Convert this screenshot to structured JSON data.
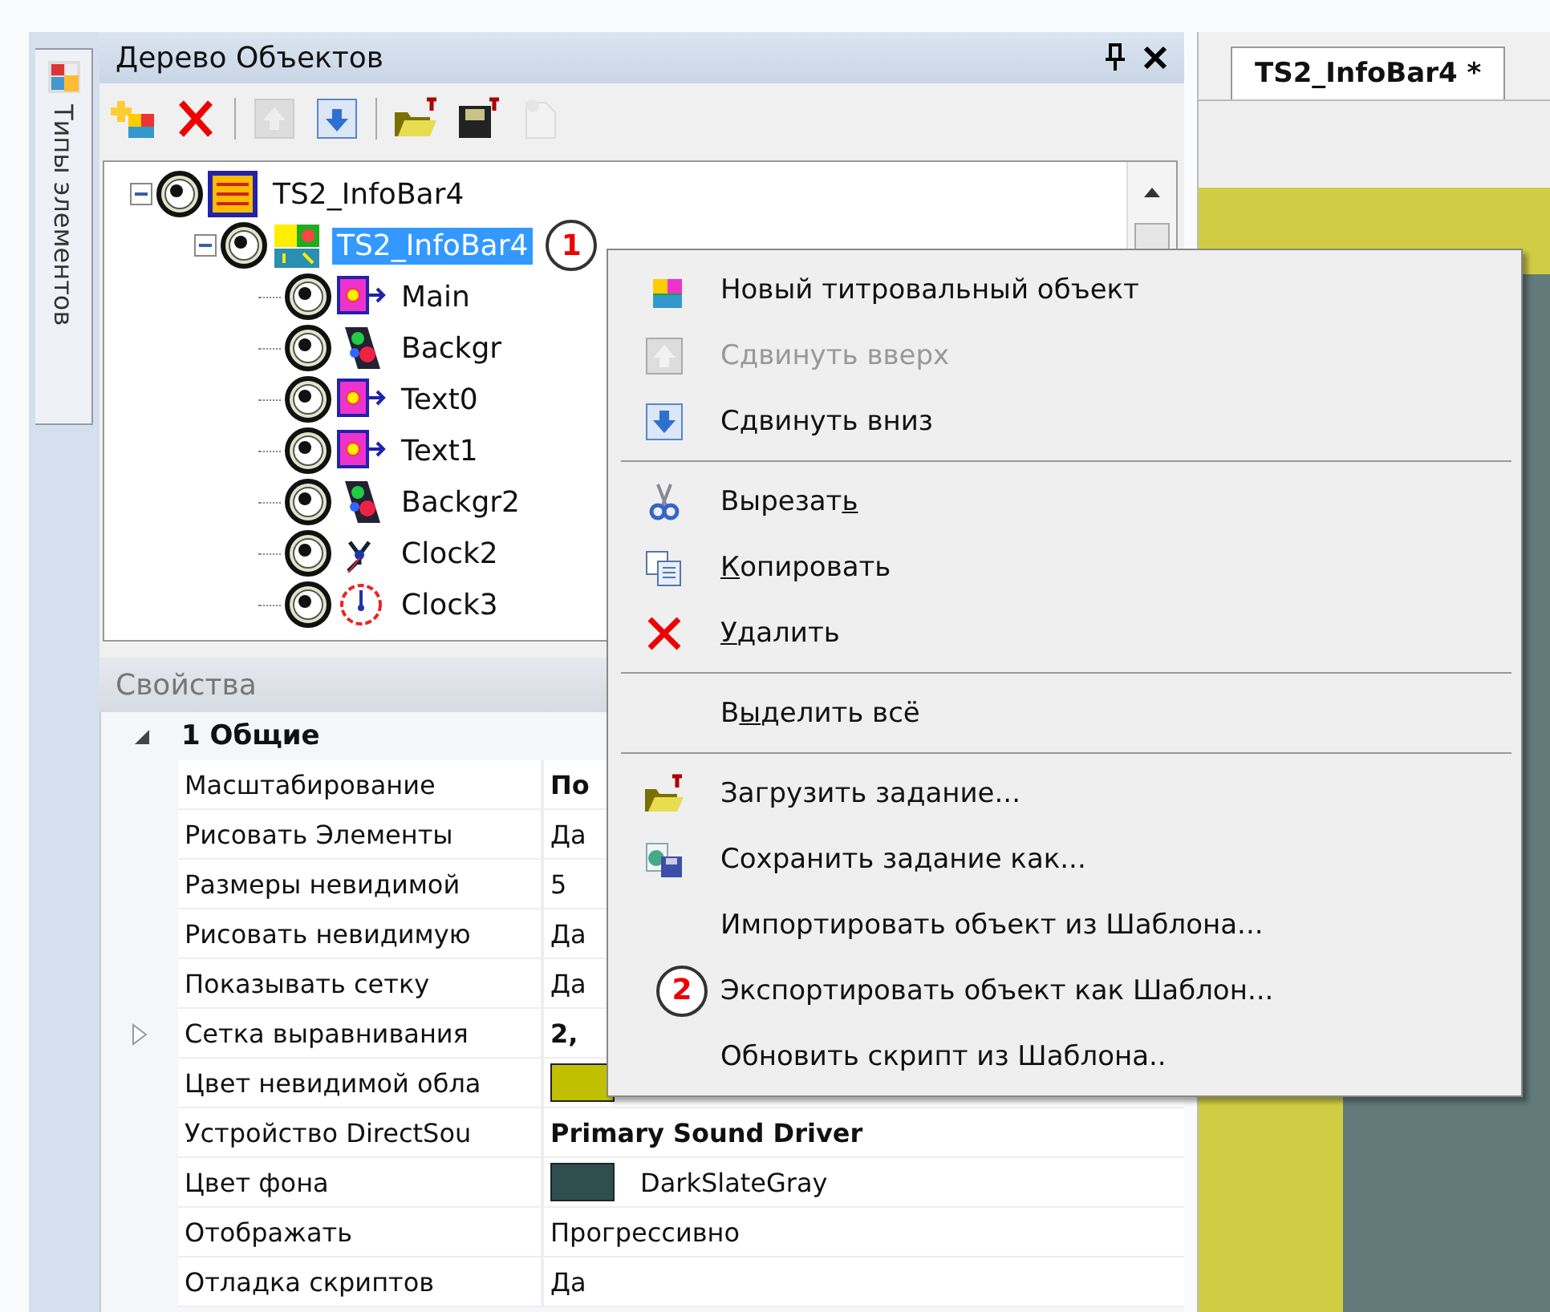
{
  "side_tab": {
    "label": "Типы элементов"
  },
  "object_tree_panel": {
    "title": "Дерево Объектов",
    "toolbar": [
      {
        "kind": "add",
        "disabled": false
      },
      {
        "kind": "delete",
        "disabled": false
      },
      {
        "kind": "up",
        "disabled": true
      },
      {
        "kind": "down",
        "disabled": false
      },
      {
        "kind": "open",
        "disabled": false
      },
      {
        "kind": "save",
        "disabled": false
      },
      {
        "kind": "new",
        "disabled": true
      }
    ],
    "tree": [
      {
        "label": "TS2_InfoBar4",
        "kind": "scene",
        "expanded": true,
        "selected": false,
        "children": [
          {
            "label": "TS2_InfoBar4",
            "kind": "group",
            "expanded": true,
            "selected": true,
            "callout": "1",
            "children": [
              {
                "label": "Main",
                "kind": "text",
                "selected": false
              },
              {
                "label": "Backgr",
                "kind": "background",
                "selected": false
              },
              {
                "label": "Text0",
                "kind": "text",
                "selected": false
              },
              {
                "label": "Text1",
                "kind": "text",
                "selected": false
              },
              {
                "label": "Backgr2",
                "kind": "background",
                "selected": false
              },
              {
                "label": "Clock2",
                "kind": "clock",
                "selected": false
              },
              {
                "label": "Clock3",
                "kind": "analog-clock",
                "selected": false
              }
            ]
          }
        ]
      }
    ]
  },
  "properties_panel": {
    "title": "Свойства",
    "category": {
      "label": "1 Общие",
      "expanded": true
    },
    "rows": [
      {
        "name": "Масштабирование",
        "value": "По",
        "bold": true,
        "expandable": false
      },
      {
        "name": "Рисовать Элементы",
        "value": "Да",
        "bold": false,
        "expandable": false
      },
      {
        "name": "Размеры невидимой",
        "value": "5",
        "bold": false,
        "expandable": false
      },
      {
        "name": "Рисовать невидимую",
        "value": "Да",
        "bold": false,
        "expandable": false
      },
      {
        "name": "Показывать сетку",
        "value": "Да",
        "bold": false,
        "expandable": false
      },
      {
        "name": "Сетка выравнивания",
        "value": "2,",
        "bold": true,
        "expandable": true
      },
      {
        "name": "Цвет невидимой обла",
        "color": "#c0c000",
        "expandable": false
      },
      {
        "name": "Устройство DirectSou",
        "value": "Primary Sound Driver",
        "bold": true,
        "expandable": false
      },
      {
        "name": "Цвет фона",
        "value": "DarkSlateGray",
        "color": "#2f4f4f",
        "bold": false,
        "expandable": false
      },
      {
        "name": "Отображать",
        "value": "Прогрессивно",
        "bold": false,
        "expandable": false
      },
      {
        "name": "Отладка скриптов",
        "value": "Да",
        "bold": false,
        "expandable": false
      }
    ]
  },
  "editor": {
    "tab": {
      "label": "TS2_InfoBar4 *",
      "selected": true
    }
  },
  "context_menu": [
    {
      "kind": "new-object",
      "label": "Новый титровальный объект",
      "disabled": false
    },
    {
      "kind": "up",
      "label": "Сдвинуть вверх",
      "disabled": true
    },
    {
      "kind": "down",
      "label": "Сдвинуть вниз",
      "disabled": false
    },
    {
      "kind": "separator"
    },
    {
      "kind": "cut",
      "label": {
        "before": "Вырезат",
        "access_key": "ь"
      },
      "disabled": false
    },
    {
      "kind": "copy",
      "label": {
        "access_key": "К",
        "after": "опировать"
      },
      "disabled": false
    },
    {
      "kind": "delete",
      "label": {
        "access_key": "У",
        "after": "далить"
      },
      "disabled": false
    },
    {
      "kind": "separator"
    },
    {
      "kind": "plain",
      "label": {
        "before": "В",
        "access_key": "ы",
        "after": "делить всё"
      },
      "disabled": false
    },
    {
      "kind": "separator"
    },
    {
      "kind": "open",
      "label": "Загрузить задание...",
      "disabled": false
    },
    {
      "kind": "save",
      "label": "Сохранить задание как...",
      "disabled": false
    },
    {
      "kind": "plain",
      "label": "Импортировать объект из Шаблона...",
      "disabled": false
    },
    {
      "kind": "plain",
      "label": "Экспортировать объект как  Шаблон...",
      "disabled": false,
      "callout": "2"
    },
    {
      "kind": "plain",
      "label": "Обновить скрипт из Шаблона..",
      "disabled": false
    }
  ]
}
